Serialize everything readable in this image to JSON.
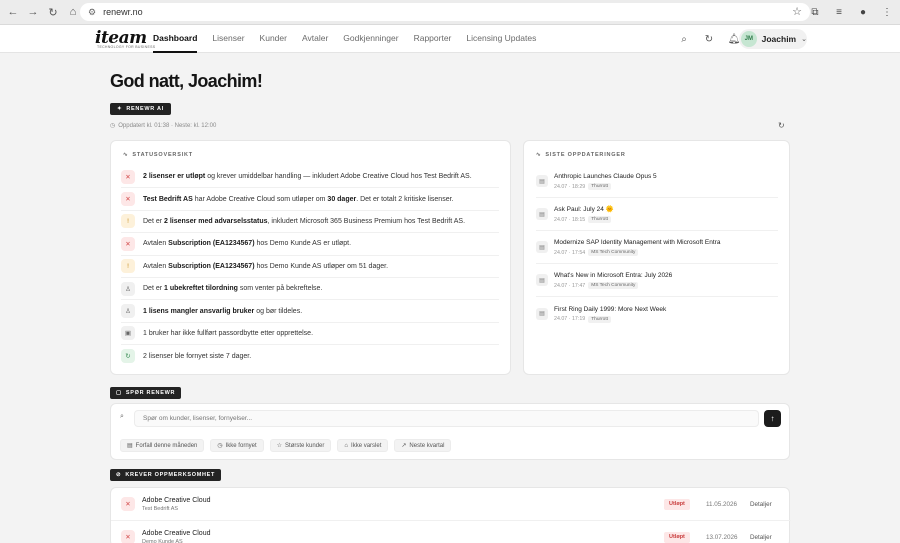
{
  "browser": {
    "url": "renewr.no"
  },
  "app": {
    "logo": "iteam",
    "logo_sub": "TECHNOLOGY FOR BUSINESS",
    "nav": [
      "Dashboard",
      "Lisenser",
      "Kunder",
      "Avtaler",
      "Godkjenninger",
      "Rapporter",
      "Licensing Updates"
    ],
    "active_nav": "Dashboard",
    "user": {
      "initials": "JM",
      "name": "Joachim"
    }
  },
  "greeting": "God natt, Joachim!",
  "ai_button": "RENEWR AI",
  "updated_text": "Oppdatert kl. 01:38 · Neste: kl. 12:00",
  "status": {
    "title": "STATUSOVERSIKT",
    "rows": [
      {
        "type": "red",
        "icon": "✕",
        "parts": [
          [
            "b",
            "2 lisenser er utløpt"
          ],
          [
            "t",
            " og krever umiddelbar handling — inkludert Adobe Creative Cloud hos Test Bedrift AS."
          ]
        ]
      },
      {
        "type": "red",
        "icon": "✕",
        "parts": [
          [
            "b",
            "Test Bedrift AS"
          ],
          [
            "t",
            " har Adobe Creative Cloud som utløper om "
          ],
          [
            "b",
            "30 dager"
          ],
          [
            "t",
            ". Det er totalt 2 kritiske lisenser."
          ]
        ]
      },
      {
        "type": "amber",
        "icon": "!",
        "parts": [
          [
            "t",
            "Det er "
          ],
          [
            "b",
            "2 lisenser med advarselsstatus"
          ],
          [
            "t",
            ", inkludert Microsoft 365 Business Premium hos Test Bedrift AS."
          ]
        ]
      },
      {
        "type": "red",
        "icon": "✕",
        "parts": [
          [
            "t",
            "Avtalen "
          ],
          [
            "b",
            "Subscription (EA1234567)"
          ],
          [
            "t",
            " hos Demo Kunde AS er utløpt."
          ]
        ]
      },
      {
        "type": "amber",
        "icon": "!",
        "parts": [
          [
            "t",
            "Avtalen "
          ],
          [
            "b",
            "Subscription (EA1234567)"
          ],
          [
            "t",
            " hos Demo Kunde AS utløper om 51 dager."
          ]
        ]
      },
      {
        "type": "gray",
        "icon": "♙",
        "parts": [
          [
            "t",
            "Det er "
          ],
          [
            "b",
            "1 ubekreftet tilordning"
          ],
          [
            "t",
            " som venter på bekreftelse."
          ]
        ]
      },
      {
        "type": "gray",
        "icon": "♙",
        "parts": [
          [
            "b",
            "1 lisens mangler ansvarlig bruker"
          ],
          [
            "t",
            " og bør tildeles."
          ]
        ]
      },
      {
        "type": "gray",
        "icon": "▣",
        "parts": [
          [
            "t",
            "1 bruker har ikke fullført passordbytte etter opprettelse."
          ]
        ]
      },
      {
        "type": "green",
        "icon": "↻",
        "parts": [
          [
            "t",
            "2 lisenser ble fornyet siste 7 dager."
          ]
        ]
      }
    ]
  },
  "updates": {
    "title": "SISTE OPPDATERINGER",
    "items": [
      {
        "title": "Anthropic Launches Claude Opus 5",
        "time": "24.07 · 18:29",
        "source": "Thurrott"
      },
      {
        "title": "Ask Paul: July 24 🌞",
        "time": "24.07 · 18:15",
        "source": "Thurrott"
      },
      {
        "title": "Modernize SAP Identity Management with Microsoft Entra",
        "time": "24.07 · 17:54",
        "source": "MS Tech Community"
      },
      {
        "title": "What's New in Microsoft Entra: July 2026",
        "time": "24.07 · 17:47",
        "source": "MS Tech Community"
      },
      {
        "title": "First Ring Daily 1999: More Next Week",
        "time": "24.07 · 17:19",
        "source": "Thurrott"
      }
    ]
  },
  "ask": {
    "label": "SPØR RENEWR",
    "placeholder": "Spør om kunder, lisenser, fornyelser...",
    "chips": [
      {
        "icon": "▤",
        "label": "Forfall denne måneden"
      },
      {
        "icon": "◷",
        "label": "Ikke fornyet"
      },
      {
        "icon": "☆",
        "label": "Største kunder"
      },
      {
        "icon": "⌂",
        "label": "Ikke varslet"
      },
      {
        "icon": "↗",
        "label": "Neste kvartal"
      }
    ]
  },
  "attention": {
    "label": "KREVER OPPMERKSOMHET",
    "rows": [
      {
        "name": "Adobe Creative Cloud",
        "customer": "Test Bedrift AS",
        "status": "Utløpt",
        "date": "11.05.2026",
        "action": "Detaljer"
      },
      {
        "name": "Adobe Creative Cloud",
        "customer": "Demo Kunde AS",
        "status": "Utløpt",
        "date": "13.07.2026",
        "action": "Detaljer"
      }
    ]
  }
}
